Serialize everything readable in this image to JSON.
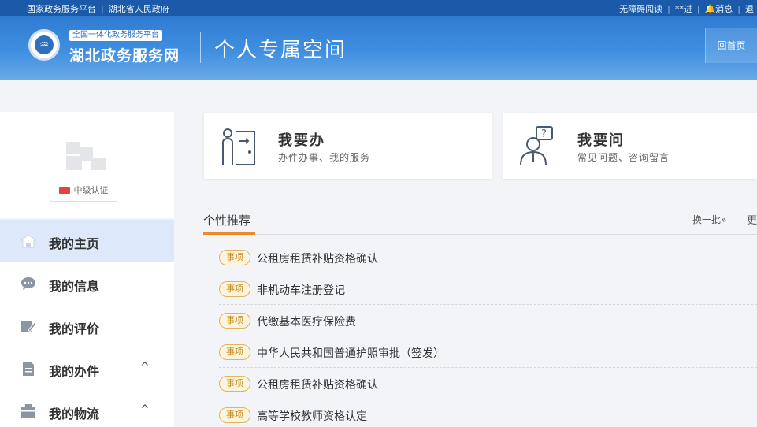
{
  "topbar": {
    "left_links": [
      "国家政务服务平台",
      "湖北省人民政府"
    ],
    "right_links": [
      "无障碍阅读",
      "**进",
      "消息",
      "退"
    ]
  },
  "header": {
    "brand_tag": "全国一体化政务服务平台",
    "brand_name": "湖北政务服务网",
    "page_title": "个人专属空间",
    "home_button": "回首页"
  },
  "profile": {
    "cert_level": "中级认证"
  },
  "sidebar": {
    "items": [
      {
        "label": "我的主页",
        "icon": "home-icon",
        "active": true
      },
      {
        "label": "我的信息",
        "icon": "message-icon",
        "active": false
      },
      {
        "label": "我的评价",
        "icon": "review-icon",
        "active": false
      },
      {
        "label": "我的办件",
        "icon": "document-icon",
        "active": false,
        "chevron": "^"
      },
      {
        "label": "我的物流",
        "icon": "logistics-icon",
        "active": false,
        "chevron": "^"
      }
    ]
  },
  "actions": [
    {
      "title": "我要办",
      "subtitle": "办件办事、我的服务",
      "icon": "person-process-icon"
    },
    {
      "title": "我要问",
      "subtitle": "常见问题、咨询留言",
      "icon": "person-question-icon"
    }
  ],
  "recommendations": {
    "title": "个性推荐",
    "refresh": "换一批»",
    "more": "更",
    "tag": "事项",
    "items": [
      "公租房租赁补贴资格确认",
      "非机动车注册登记",
      "代缴基本医疗保险费",
      "中华人民共和国普通护照审批（签发）",
      "公租房租赁补贴资格确认",
      "高等学校教师资格认定"
    ]
  },
  "colors": {
    "topbar": "#1a5aa8",
    "banner": "#3f8fe0",
    "accent_orange": "#f08a28",
    "active_nav": "#dde9fa",
    "tag_gold": "#c98a1a"
  }
}
